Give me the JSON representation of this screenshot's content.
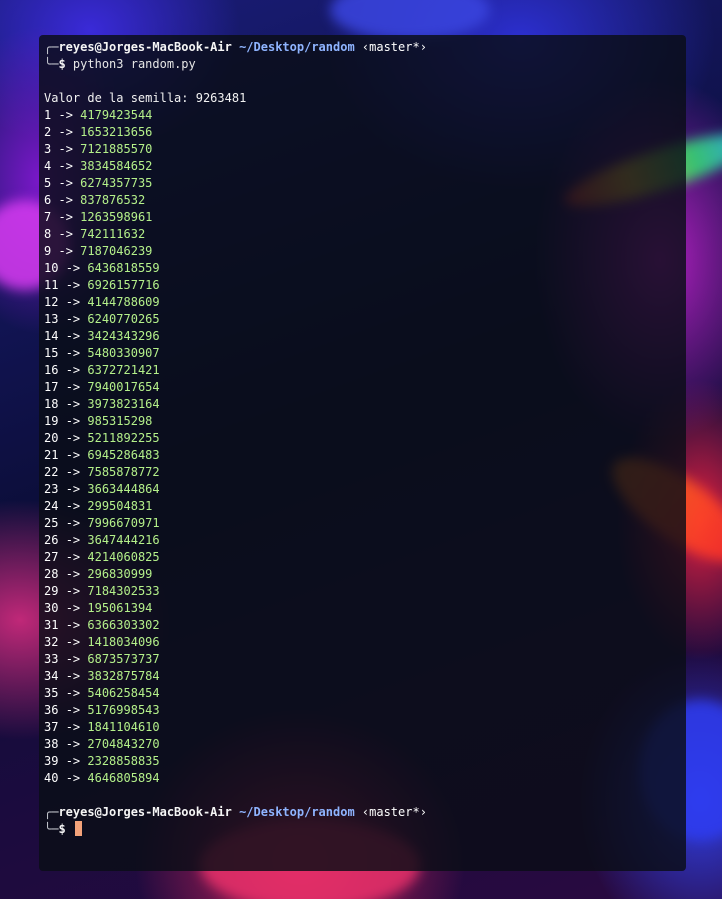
{
  "terminal": {
    "prompt": {
      "user_host": "reyes@Jorges-MacBook-Air",
      "path": "~/Desktop/random",
      "git": "‹master*›",
      "symbol": "$"
    },
    "command": "python3 random.py",
    "seed_line": "Valor de la semilla: 9263481",
    "results": [
      {
        "n": "1",
        "v": "4179423544"
      },
      {
        "n": "2",
        "v": "1653213656"
      },
      {
        "n": "3",
        "v": "7121885570"
      },
      {
        "n": "4",
        "v": "3834584652"
      },
      {
        "n": "5",
        "v": "6274357735"
      },
      {
        "n": "6",
        "v": "837876532"
      },
      {
        "n": "7",
        "v": "1263598961"
      },
      {
        "n": "8",
        "v": "742111632"
      },
      {
        "n": "9",
        "v": "7187046239"
      },
      {
        "n": "10",
        "v": "6436818559"
      },
      {
        "n": "11",
        "v": "6926157716"
      },
      {
        "n": "12",
        "v": "4144788609"
      },
      {
        "n": "13",
        "v": "6240770265"
      },
      {
        "n": "14",
        "v": "3424343296"
      },
      {
        "n": "15",
        "v": "5480330907"
      },
      {
        "n": "16",
        "v": "6372721421"
      },
      {
        "n": "17",
        "v": "7940017654"
      },
      {
        "n": "18",
        "v": "3973823164"
      },
      {
        "n": "19",
        "v": "985315298"
      },
      {
        "n": "20",
        "v": "5211892255"
      },
      {
        "n": "21",
        "v": "6945286483"
      },
      {
        "n": "22",
        "v": "7585878772"
      },
      {
        "n": "23",
        "v": "3663444864"
      },
      {
        "n": "24",
        "v": "299504831"
      },
      {
        "n": "25",
        "v": "7996670971"
      },
      {
        "n": "26",
        "v": "3647444216"
      },
      {
        "n": "27",
        "v": "4214060825"
      },
      {
        "n": "28",
        "v": "296830999"
      },
      {
        "n": "29",
        "v": "7184302533"
      },
      {
        "n": "30",
        "v": "195061394"
      },
      {
        "n": "31",
        "v": "6366303302"
      },
      {
        "n": "32",
        "v": "1418034096"
      },
      {
        "n": "33",
        "v": "6873573737"
      },
      {
        "n": "34",
        "v": "3832875784"
      },
      {
        "n": "35",
        "v": "5406258454"
      },
      {
        "n": "36",
        "v": "5176998543"
      },
      {
        "n": "37",
        "v": "1841104610"
      },
      {
        "n": "38",
        "v": "2704843270"
      },
      {
        "n": "39",
        "v": "2328858835"
      },
      {
        "n": "40",
        "v": "4646805894"
      }
    ],
    "arrow": "->",
    "colors": {
      "value": "#b4f08a",
      "path": "#8fb4ff",
      "cursor": "#f3a27a"
    }
  }
}
